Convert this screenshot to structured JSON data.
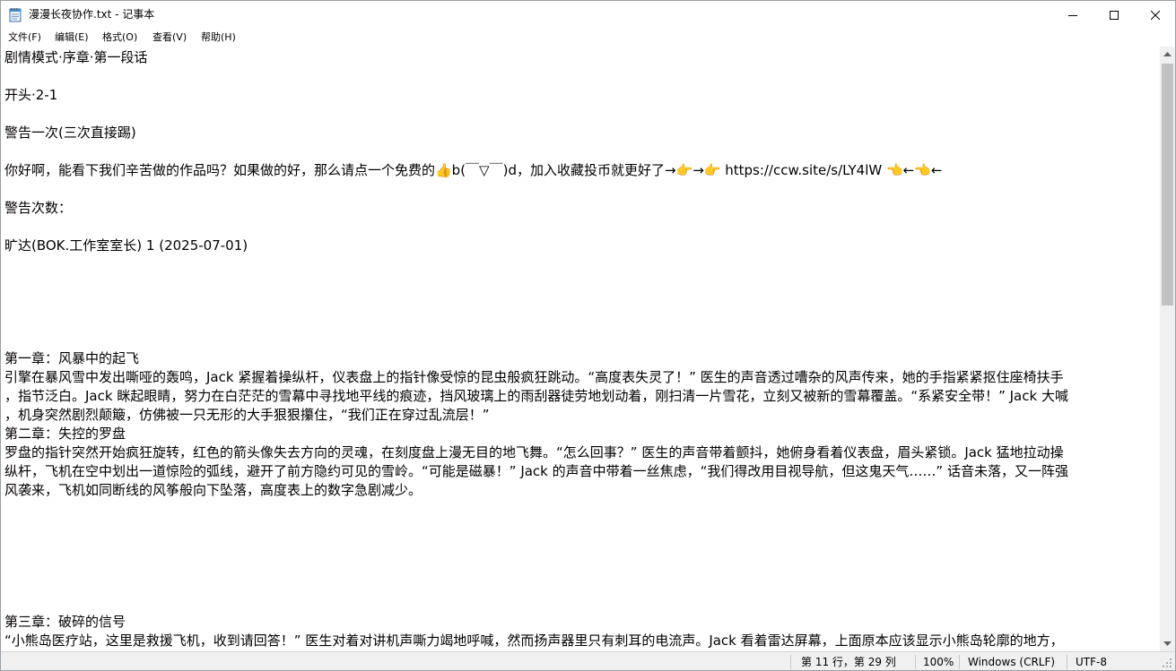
{
  "window": {
    "title": "漫漫长夜协作.txt - 记事本"
  },
  "menu": {
    "items": [
      "文件(F)",
      "编辑(E)",
      "格式(O)",
      "查看(V)",
      "帮助(H)"
    ]
  },
  "document": {
    "lines": [
      "剧情模式·序章·第一段话",
      "开头·2-1",
      "警告一次(三次直接踢)",
      "你好啊，能看下我们辛苦做的作品吗？如果做的好，那么请点一个免费的👍b(￣▽￣)d，加入收藏投币就更好了→👉→👉 https://ccw.site/s/LY4lW 👈←👈←",
      "警告次数：",
      "旷达(BOK.工作室室长) 1 (2025-07-01)",
      "第一章：风暴中的起飞",
      "引擎在暴风雪中发出嘶哑的轰鸣，Jack 紧握着操纵杆，仪表盘上的指针像受惊的昆虫般疯狂跳动。“高度表失灵了！” 医生的声音透过嘈杂的风声传来，她的手指紧紧抠住座椅扶手",
      "，指节泛白。Jack 眯起眼睛，努力在白茫茫的雪幕中寻找地平线的痕迹，挡风玻璃上的雨刮器徒劳地划动着，刚扫清一片雪花，立刻又被新的雪幕覆盖。“系紧安全带！” Jack 大喊",
      "，机身突然剧烈颠簸，仿佛被一只无形的大手狠狠攥住，“我们正在穿过乱流层！”",
      "第二章：失控的罗盘",
      "罗盘的指针突然开始疯狂旋转，红色的箭头像失去方向的灵魂，在刻度盘上漫无目的地飞舞。“怎么回事？” 医生的声音带着颤抖，她俯身看着仪表盘，眉头紧锁。Jack 猛地拉动操",
      "纵杆，飞机在空中划出一道惊险的弧线，避开了前方隐约可见的雪岭。“可能是磁暴！” Jack 的声音中带着一丝焦虑，“我们得改用目视导航，但这鬼天气……” 话音未落，又一阵强",
      "风袭来，飞机如同断线的风筝般向下坠落，高度表上的数字急剧减少。",
      "第三章：破碎的信号",
      "“小熊岛医疗站，这里是救援飞机，收到请回答！” 医生对着对讲机声嘶力竭地呼喊，然而扬声器里只有刺耳的电流声。Jack 看着雷达屏幕，上面原本应该显示小熊岛轮廓的地方，"
    ]
  },
  "status": {
    "position": "第 11 行，第 29 列",
    "zoom": "100%",
    "line_ending": "Windows (CRLF)",
    "encoding": "UTF-8"
  },
  "icons": {
    "app": "notepad-icon",
    "minimize": "minimize-icon",
    "maximize": "maximize-icon",
    "close": "close-icon",
    "scroll_up": "chevron-up-icon",
    "scroll_down": "chevron-down-icon"
  }
}
